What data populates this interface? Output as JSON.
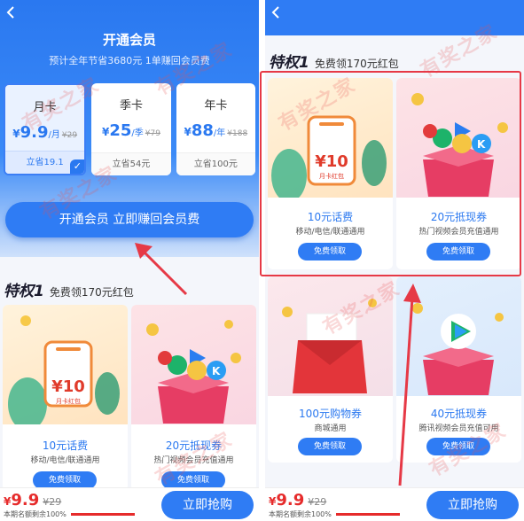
{
  "left": {
    "header": {
      "title": "开通会员",
      "subtitle": "预计全年节省3680元 1单赚回会员费"
    },
    "plans": [
      {
        "name": "月卡",
        "currency": "¥",
        "price": "9.9",
        "unit": "/月",
        "old": "¥29",
        "save": "立省19.1",
        "selected": true
      },
      {
        "name": "季卡",
        "currency": "¥",
        "price": "25",
        "unit": "/季",
        "old": "¥79",
        "save": "立省54元",
        "selected": false
      },
      {
        "name": "年卡",
        "currency": "¥",
        "price": "88",
        "unit": "/年",
        "old": "¥188",
        "save": "立省100元",
        "selected": false
      }
    ],
    "cta_label": "开通会员 立即赚回会员费"
  },
  "privilege": {
    "title": "特权1",
    "subtitle": "免费领170元红包"
  },
  "cards": [
    {
      "title": "10元话费",
      "desc": "移动/电信/联通通用",
      "button": "免费领取",
      "art_text": "¥10",
      "art_sub": "月卡红包"
    },
    {
      "title": "20元抵现券",
      "desc": "热门视频会员充值通用",
      "button": "免费领取"
    },
    {
      "title": "100元购物券",
      "desc": "商城通用",
      "button": "免费领取"
    },
    {
      "title": "40元抵现券",
      "desc": "腾讯视频会员充值可用",
      "button": "免费领取"
    }
  ],
  "bottom_bar": {
    "currency": "¥",
    "price": "9.9",
    "old": "¥29",
    "remaining": "本期名额剩余100%",
    "remaining_fraction": 1.0,
    "buy_label": "立即抢购"
  },
  "watermark": "有奖之家",
  "colors": {
    "primary": "#2f7cf4",
    "price_red": "#e62b2b",
    "highlight_red": "#e63946"
  }
}
